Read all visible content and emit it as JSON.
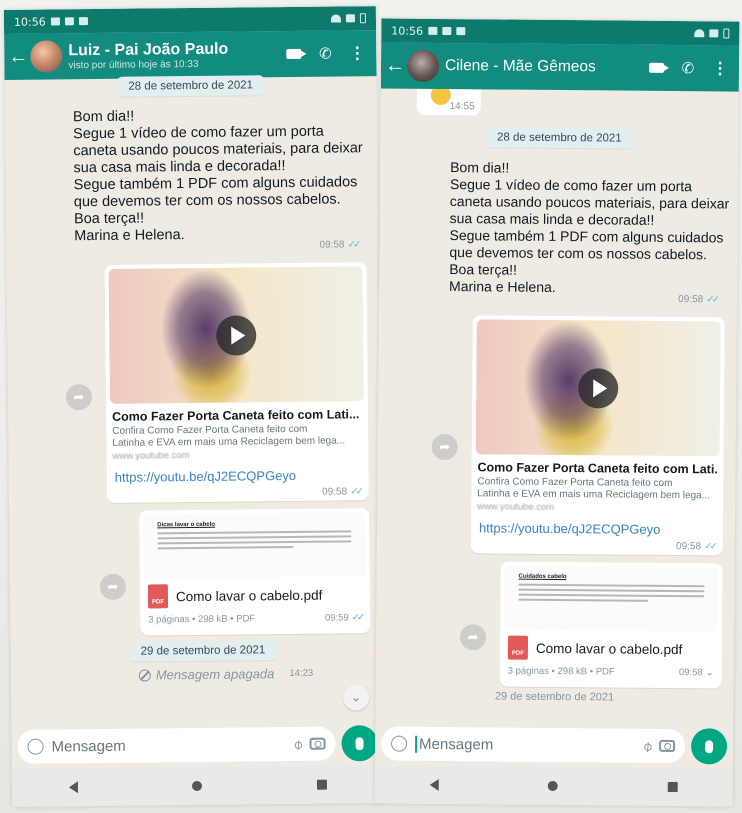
{
  "left": {
    "status": {
      "time": "10:56"
    },
    "appbar": {
      "contact_name": "Luiz - Pai João Paulo",
      "contact_status": "visto por último hoje às 10:33"
    },
    "date1": "28 de setembro de 2021",
    "message": {
      "lines": [
        "Bom dia!!",
        "Segue 1 vídeo de como fazer um porta",
        "caneta usando poucos materiais, para deixar",
        "sua casa mais linda e decorada!!",
        "Segue também 1 PDF com alguns cuidados",
        "que devemos ter com os nossos cabelos.",
        "Boa terça!!",
        "Marina e Helena."
      ],
      "time": "09:58"
    },
    "video": {
      "title": "Como Fazer Porta Caneta feito com Lati...",
      "desc1": "Confira Como Fazer Porta Caneta feito com",
      "desc2": "Latinha e EVA em mais uma Reciclagem bem lega...",
      "domain": "www.youtube.com",
      "url": "https://youtu.be/qJ2ECQPGeyo",
      "time": "09:58"
    },
    "document": {
      "heading": "Dicas lavar o cabelo",
      "name": "Como lavar o cabelo.pdf",
      "meta": "3 páginas • 298 kB • PDF",
      "time": "09:59",
      "pdf_label": "PDF"
    },
    "date2": "29 de setembro de 2021",
    "deleted": {
      "text": "Mensagem apagada",
      "time": "14:23"
    },
    "input": {
      "placeholder": "Mensagem"
    }
  },
  "right": {
    "status": {
      "time": "10:56"
    },
    "appbar": {
      "contact_name": "Cilene - Mãe Gêmeos"
    },
    "prev_time": "14:55",
    "date1": "28 de setembro de 2021",
    "message": {
      "lines": [
        "Bom dia!!",
        "Segue 1 vídeo de como fazer um porta",
        "caneta usando poucos materiais, para deixar",
        "sua casa mais linda e decorada!!",
        "Segue também 1 PDF com alguns cuidados",
        "que devemos ter com os nossos cabelos.",
        "Boa terça!!",
        "Marina e Helena."
      ],
      "time": "09:58"
    },
    "video": {
      "title": "Como Fazer Porta Caneta feito com Lati...",
      "desc1": "Confira Como Fazer Porta Caneta feito com",
      "desc2": "Latinha e EVA em mais uma Reciclagem bem lega...",
      "domain": "www.youtube.com",
      "url": "https://youtu.be/qJ2ECQPGeyo",
      "time": "09:58"
    },
    "document": {
      "heading": "Cuidados cabelo",
      "name": "Como lavar o cabelo.pdf",
      "meta": "3 páginas • 298 kB • PDF",
      "time": "09:58",
      "pdf_label": "PDF"
    },
    "date2": "29 de setembro de 2021",
    "input": {
      "placeholder": "Mensagem"
    }
  },
  "colors": {
    "header": "#128c7e",
    "statusbar": "#0e7a6d",
    "accent": "#00a884",
    "chat_bg": "#efeae2",
    "link": "#3b82c4",
    "read_ticks": "#53bdeb"
  },
  "icons": [
    "back-arrow-icon",
    "video-call-icon",
    "phone-icon",
    "menu-icon",
    "play-icon",
    "forward-icon",
    "pdf-icon",
    "emoji-icon",
    "attach-icon",
    "camera-icon",
    "mic-icon",
    "ban-icon",
    "chevron-down-icon"
  ]
}
